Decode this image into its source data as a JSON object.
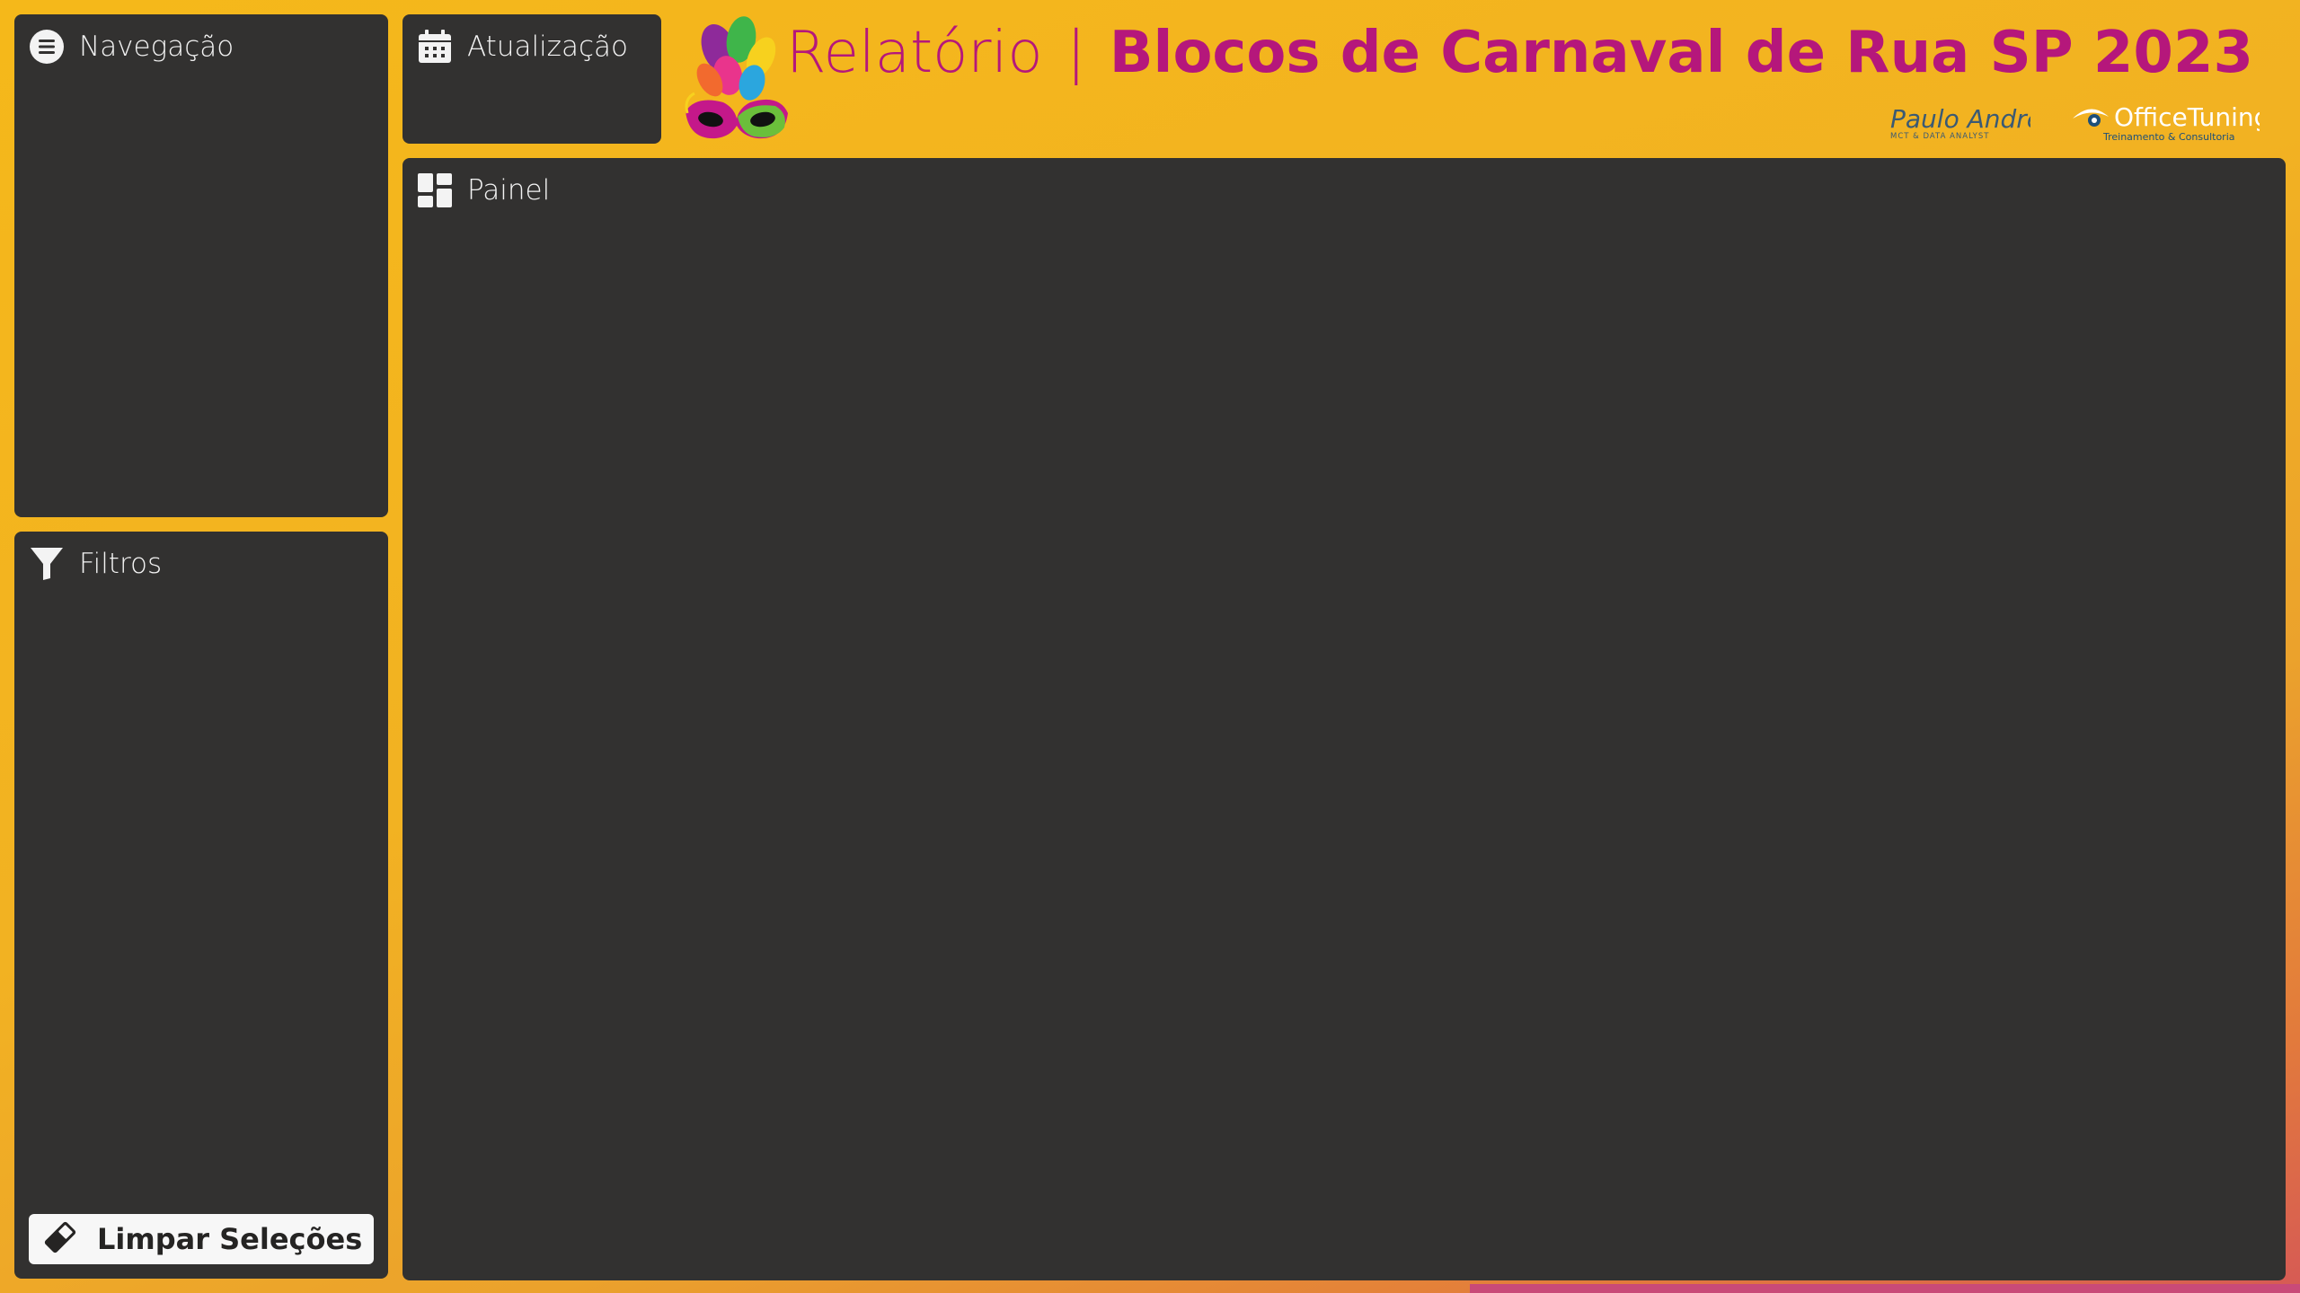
{
  "header": {
    "title_light": "Relatório",
    "title_sep": "|",
    "title_bold": "Blocos de Carnaval de Rua SP 2023",
    "logo1_main": "Paulo Andre",
    "logo1_sub": "MCT & DATA ANALYST",
    "logo2_main": "OfficeTuning",
    "logo2_sub": "Treinamento & Consultoria",
    "title_color": "#b5177b"
  },
  "panels": {
    "navigation": {
      "label": "Navegação",
      "icon": "menu-icon"
    },
    "filters": {
      "label": "Filtros",
      "icon": "filter-icon"
    },
    "update": {
      "label": "Atualização",
      "icon": "calendar-icon"
    },
    "dashboard": {
      "label": "Painel",
      "icon": "dashboard-icon"
    }
  },
  "actions": {
    "clear_label": "Limpar Seleções",
    "clear_icon": "eraser-icon"
  },
  "colors": {
    "panel_bg": "#323130",
    "background": "#f5b81a",
    "accent": "#b5177b"
  }
}
